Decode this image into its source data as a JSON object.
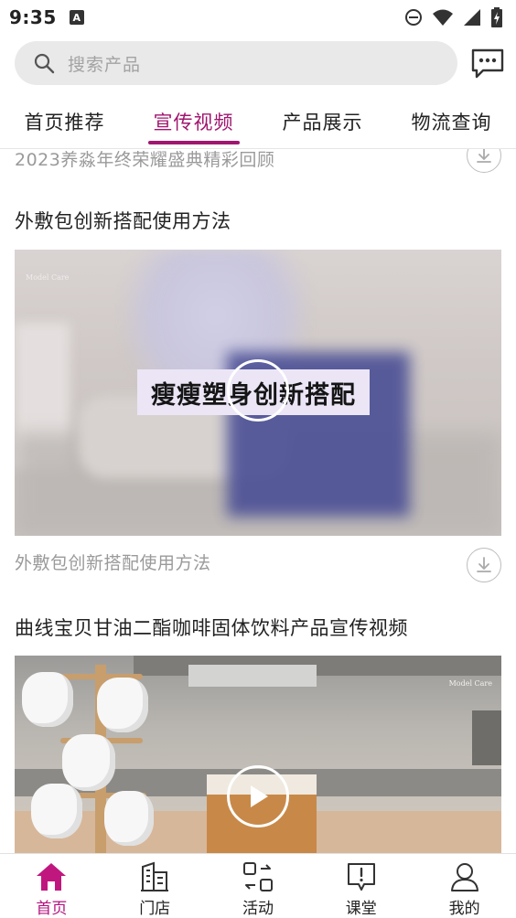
{
  "status_bar": {
    "time": "9:35",
    "notification_letter": "A"
  },
  "search": {
    "placeholder": "搜索产品",
    "icon": "search-icon"
  },
  "header": {
    "message_icon": "message-icon"
  },
  "tabs": [
    {
      "label": "首页推荐",
      "active": false
    },
    {
      "label": "宣传视频",
      "active": true
    },
    {
      "label": "产品展示",
      "active": false
    },
    {
      "label": "物流查询",
      "active": false
    }
  ],
  "accent_color": "#a0166f",
  "feed": {
    "previous_caption": "2023养淼年终荣耀盛典精彩回顾",
    "videos": [
      {
        "title": "外敷包创新搭配使用方法",
        "banner_text": "瘦瘦塑身创新搭配",
        "brand_text": "Model Care",
        "caption": "外敷包创新搭配使用方法"
      },
      {
        "title": "曲线宝贝甘油二酯咖啡固体饮料产品宣传视频",
        "brand_text": "Model Care"
      }
    ]
  },
  "bottom_nav": [
    {
      "label": "首页",
      "icon": "home-icon",
      "active": true
    },
    {
      "label": "门店",
      "icon": "store-icon",
      "active": false
    },
    {
      "label": "活动",
      "icon": "activity-icon",
      "active": false
    },
    {
      "label": "课堂",
      "icon": "classroom-icon",
      "active": false
    },
    {
      "label": "我的",
      "icon": "profile-icon",
      "active": false
    }
  ]
}
